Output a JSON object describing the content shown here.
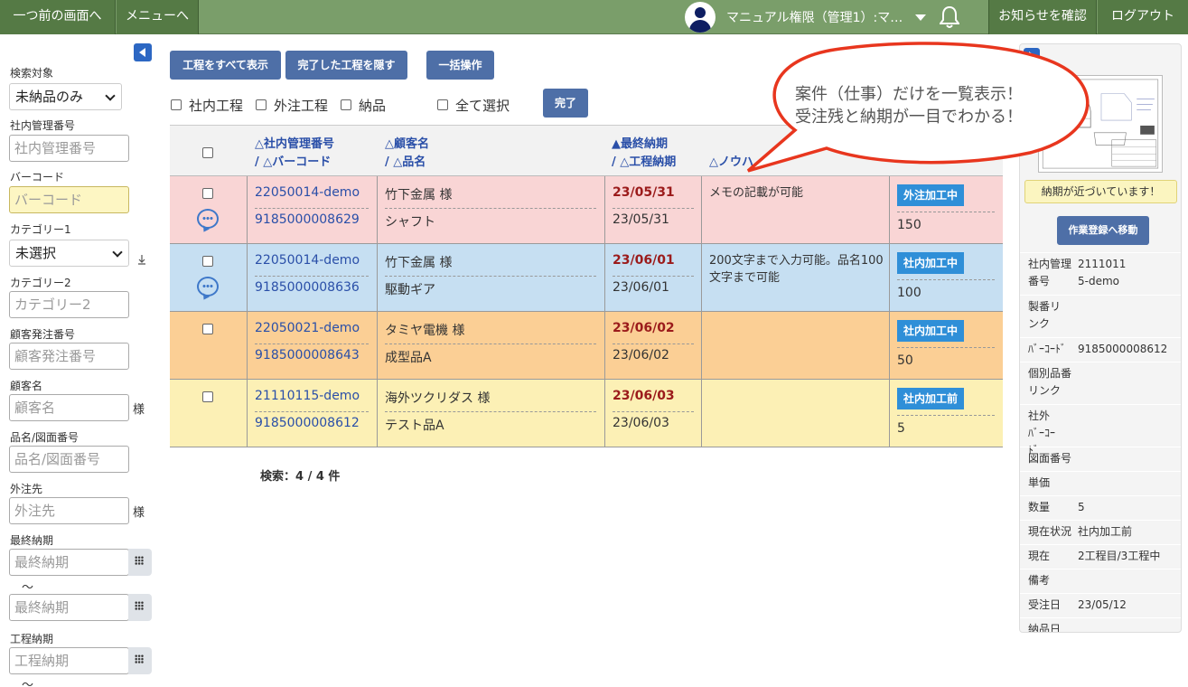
{
  "topbar": {
    "back_label": "一つ前の画面へ",
    "menu_label": "メニューへ",
    "user_name": "マニュアル権限（管理1）:マ…",
    "notices_label": "お知らせを確認",
    "logout_label": "ログアウト"
  },
  "sidebar": {
    "search_target_label": "検索対象",
    "search_target_value": "未納品のみ",
    "mgmt_no_label": "社内管理番号",
    "mgmt_no_placeholder": "社内管理番号",
    "barcode_label": "バーコード",
    "barcode_placeholder": "バーコード",
    "category1_label": "カテゴリー1",
    "category1_value": "未選択",
    "category2_label": "カテゴリー2",
    "category2_placeholder": "カテゴリー2",
    "customer_order_label": "顧客発注番号",
    "customer_order_placeholder": "顧客発注番号",
    "customer_label": "顧客名",
    "customer_placeholder": "顧客名",
    "customer_suffix": "様",
    "product_label": "品名/図面番号",
    "product_placeholder": "品名/図面番号",
    "vendor_label": "外注先",
    "vendor_placeholder": "外注先",
    "vendor_suffix": "様",
    "final_due_label": "最終納期",
    "final_due_placeholder": "最終納期",
    "final_due_to_placeholder": "最終納期",
    "range_tilde": "〜",
    "process_due_label": "工程納期",
    "process_due_placeholder": "工程納期",
    "range_tilde2": "〜"
  },
  "toolbar": {
    "show_all_label": "工程をすべて表示",
    "hide_done_label": "完了した工程を隠す",
    "bulk_label": "一括操作",
    "chk_internal": "社内工程",
    "chk_external": "外注工程",
    "chk_delivery": "納品",
    "chk_select_all": "全て選択",
    "done_label": "完了"
  },
  "table": {
    "headers": {
      "mgmt_no": "△社内管理番号",
      "barcode": "/ △バーコード",
      "customer": "△顧客名",
      "product": "/ △品名",
      "final_due": "▲最終納期",
      "process_due": "/ △工程納期",
      "knowhow": "△ノウハ",
      "status_slash": "/"
    },
    "rows": [
      {
        "mgmt_no": "22050014-demo",
        "barcode": "9185000008629",
        "customer": "竹下金属 様",
        "product": "シャフト",
        "final_due": "23/05/31",
        "process_due": "23/05/31",
        "memo": "メモの記載が可能",
        "status": "外注加工中",
        "qty": "150",
        "color": "#f9d5d5"
      },
      {
        "mgmt_no": "22050014-demo",
        "barcode": "9185000008636",
        "customer": "竹下金属 様",
        "product": "駆動ギア",
        "final_due": "23/06/01",
        "process_due": "23/06/01",
        "memo": "200文字まで入力可能。品名100文字まで可能",
        "status": "社内加工中",
        "qty": "100",
        "color": "#c6dff2"
      },
      {
        "mgmt_no": "22050021-demo",
        "barcode": "9185000008643",
        "customer": "タミヤ電機 様",
        "product": "成型品A",
        "final_due": "23/06/02",
        "process_due": "23/06/02",
        "memo": "",
        "status": "社内加工中",
        "qty": "50",
        "color": "#fbcf95"
      },
      {
        "mgmt_no": "21110115-demo",
        "barcode": "9185000008612",
        "customer": "海外ツクリダス 様",
        "product": "テスト品A",
        "final_due": "23/06/03",
        "process_due": "23/06/03",
        "memo": "",
        "status": "社内加工前",
        "qty": "5",
        "color": "#fcf0b5"
      }
    ],
    "count_text": "検索：4 / 4 件"
  },
  "bubble": {
    "line1": "案件（仕事）だけを一覧表示！",
    "line2": "受注残と納期が一目でわかる！"
  },
  "rpanel": {
    "nearing_text": "納期が近づいています！",
    "go_label": "作業登録へ移動",
    "details": [
      {
        "k": "社内管理番号",
        "v": "21110115-demo"
      },
      {
        "k": "製番リンク",
        "v": ""
      },
      {
        "k": "ﾊﾞｰｺｰﾄﾞ",
        "v": "9185000008612"
      },
      {
        "k": "個別品番リンク",
        "v": ""
      },
      {
        "k": "社外ﾊﾞｰｺｰﾄﾞ",
        "v": ""
      },
      {
        "k": "図面番号",
        "v": ""
      },
      {
        "k": "単価",
        "v": ""
      },
      {
        "k": "数量",
        "v": "5"
      },
      {
        "k": "現在状況",
        "v": "社内加工前"
      },
      {
        "k": "現在",
        "v": "2工程目/3工程中"
      },
      {
        "k": "備考",
        "v": ""
      },
      {
        "k": "受注日",
        "v": "23/05/12"
      },
      {
        "k": "納品日",
        "v": ""
      }
    ]
  }
}
